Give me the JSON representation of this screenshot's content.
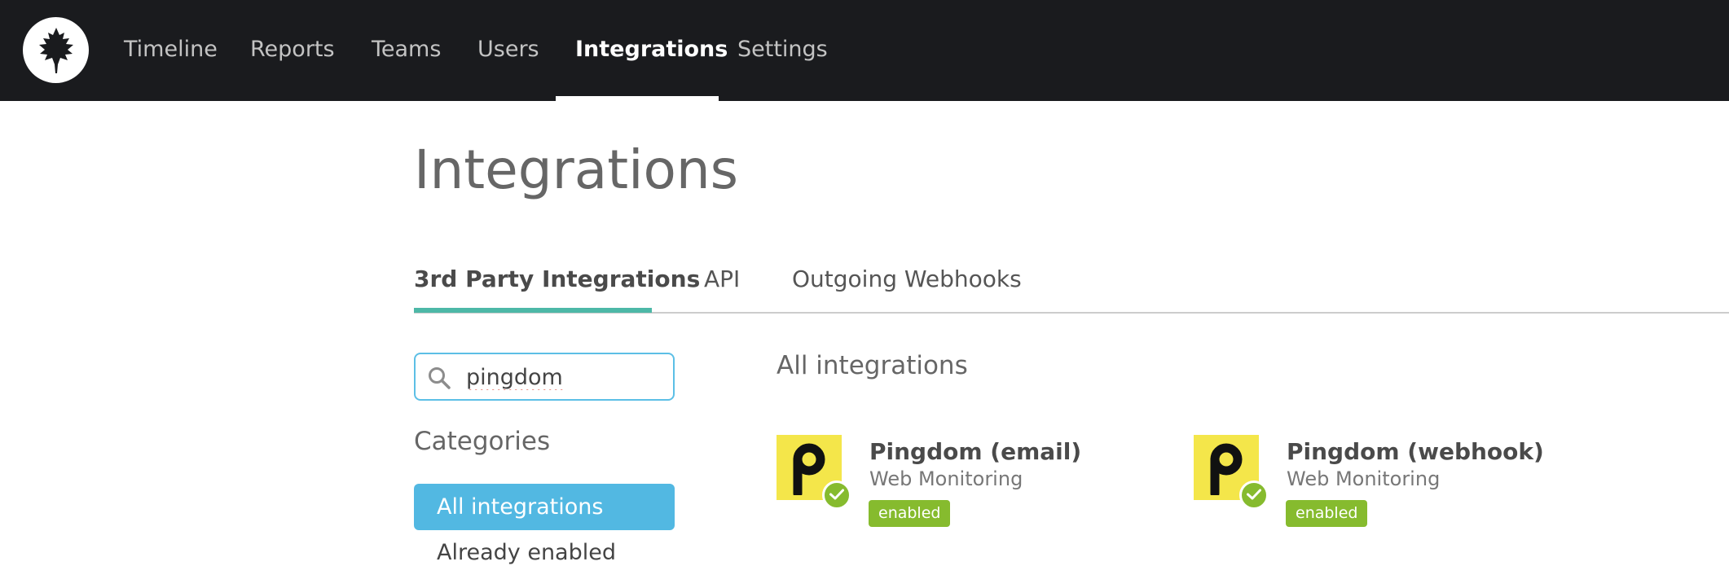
{
  "app": {
    "logo_icon": "oak-leaf-icon"
  },
  "nav": {
    "items": [
      {
        "label": "Timeline"
      },
      {
        "label": "Reports"
      },
      {
        "label": "Teams"
      },
      {
        "label": "Users"
      },
      {
        "label": "Integrations",
        "active": true
      },
      {
        "label": "Settings"
      }
    ]
  },
  "page": {
    "title": "Integrations"
  },
  "tabs": [
    {
      "label": "3rd Party Integrations",
      "active": true
    },
    {
      "label": "API"
    },
    {
      "label": "Outgoing Webhooks"
    }
  ],
  "search": {
    "value": "pingdom",
    "icon": "search-icon"
  },
  "sidebar": {
    "heading": "Categories",
    "items": [
      {
        "label": "All integrations",
        "selected": true
      },
      {
        "label": "Already enabled"
      }
    ]
  },
  "results": {
    "heading": "All integrations",
    "cards": [
      {
        "title": "Pingdom (email)",
        "category": "Web Monitoring",
        "badge": "enabled",
        "icon": "pingdom-logo-icon"
      },
      {
        "title": "Pingdom (webhook)",
        "category": "Web Monitoring",
        "badge": "enabled",
        "icon": "pingdom-logo-icon"
      }
    ]
  },
  "colors": {
    "topbar": "#1a1b1e",
    "tab_accent": "#4db8a7",
    "selection": "#52b8e2",
    "enabled_badge": "#86bb2e",
    "pingdom_yellow": "#f4e64a"
  }
}
